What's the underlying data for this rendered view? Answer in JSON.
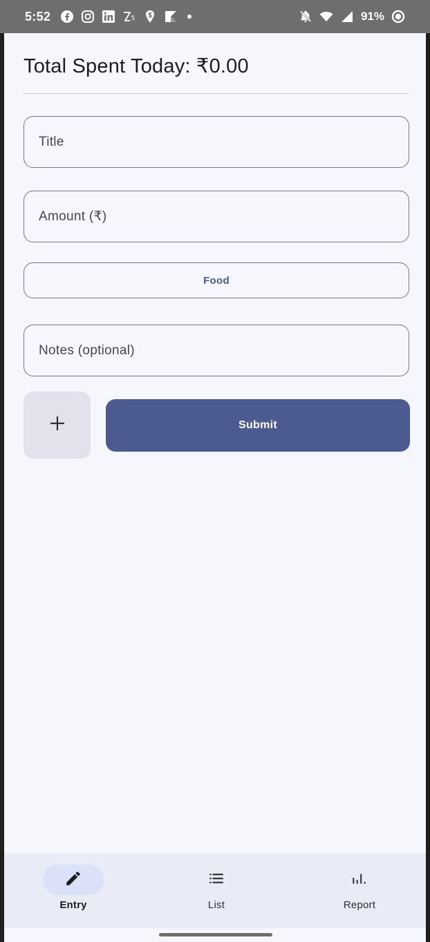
{
  "status_bar": {
    "time": "5:52",
    "battery": "91%",
    "left_icons": [
      "facebook-icon",
      "instagram-icon",
      "linkedin-icon",
      "z5-icon",
      "swiggy-icon",
      "kotlin-icon",
      "dot-icon"
    ],
    "right_icons": [
      "notifications-off-icon",
      "wifi-icon",
      "signal-icon",
      "battery-saver-icon"
    ]
  },
  "header": {
    "title": "Total Spent Today: ₹0.00"
  },
  "form": {
    "title_placeholder": "Title",
    "amount_placeholder": "Amount (₹)",
    "category_value": "Food",
    "notes_placeholder": "Notes (optional)",
    "add_icon": "plus-icon",
    "submit_label": "Submit"
  },
  "bottom_nav": {
    "items": [
      {
        "label": "Entry",
        "icon": "pencil-icon",
        "active": true
      },
      {
        "label": "List",
        "icon": "list-icon",
        "active": false
      },
      {
        "label": "Report",
        "icon": "bar-chart-icon",
        "active": false
      }
    ]
  },
  "colors": {
    "status_bar_bg": "#6e6e6e",
    "app_bg": "#f6f7fc",
    "primary": "#4b5a8f",
    "outline": "#76777f",
    "add_button_bg": "#e1e2ec",
    "nav_bg": "#e9ecf6",
    "nav_active_pill": "#dae1f9"
  }
}
